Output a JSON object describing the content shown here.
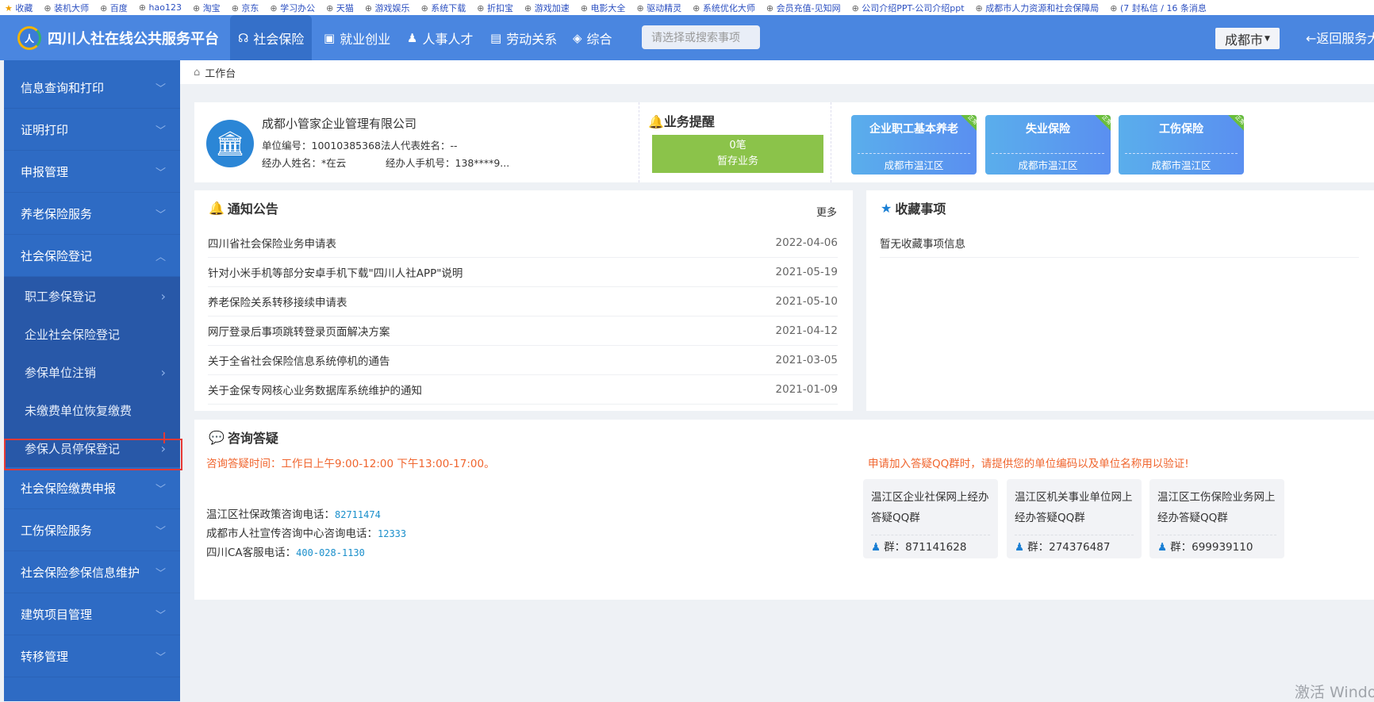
{
  "bookmarks": [
    "收藏",
    "装机大师",
    "百度",
    "hao123",
    "淘宝",
    "京东",
    "学习办公",
    "天猫",
    "游戏娱乐",
    "系统下载",
    "折扣宝",
    "游戏加速",
    "电影大全",
    "驱动精灵",
    "系统优化大师",
    "会员充值-见知网",
    "公司介绍PPT-公司介绍ppt",
    "成都市人力资源和社会保障局",
    "(7 封私信 / 16 条消息"
  ],
  "header": {
    "title": "四川人社在线公共服务平台",
    "nav": [
      {
        "label": "社会保险",
        "icon": "hands-icon"
      },
      {
        "label": "就业创业",
        "icon": "briefcase-icon"
      },
      {
        "label": "人事人才",
        "icon": "person-icon"
      },
      {
        "label": "劳动关系",
        "icon": "document-icon"
      },
      {
        "label": "综合",
        "icon": "layers-icon"
      }
    ],
    "search_placeholder": "请选择或搜索事项",
    "city": "成都市",
    "back": "←返回服务大厅"
  },
  "sidebar": {
    "top": [
      "信息查询和打印",
      "证明打印",
      "申报管理",
      "养老保险服务",
      "社会保险登记"
    ],
    "sub": [
      "职工参保登记",
      "企业社会保险登记",
      "参保单位注销",
      "未缴费单位恢复缴费",
      "参保人员停保登记"
    ],
    "bottom": [
      "社会保险缴费申报",
      "工伤保险服务",
      "社会保险参保信息维护",
      "建筑项目管理",
      "转移管理"
    ]
  },
  "breadcrumb": "工作台",
  "company": {
    "name": "成都小管家企业管理有限公司",
    "unit_no": "单位编号：10010385368",
    "legal": "法人代表姓名：--",
    "agent": "经办人姓名：*在云",
    "agent_phone": "经办人手机号：138****9..."
  },
  "reminder": {
    "title": "业务提醒",
    "count": "0笔",
    "label": "暂存业务"
  },
  "insurance": [
    {
      "name": "企业职工基本养老",
      "area": "成都市温江区",
      "tag": "正常"
    },
    {
      "name": "失业保险",
      "area": "成都市温江区",
      "tag": "正常"
    },
    {
      "name": "工伤保险",
      "area": "成都市温江区",
      "tag": "正常"
    }
  ],
  "notices": {
    "title": "通知公告",
    "more": "更多",
    "items": [
      {
        "t": "四川省社会保险业务申请表",
        "d": "2022-04-06"
      },
      {
        "t": "针对小米手机等部分安卓手机下载\"四川人社APP\"说明",
        "d": "2021-05-19"
      },
      {
        "t": "养老保险关系转移接续申请表",
        "d": "2021-05-10"
      },
      {
        "t": "网厅登录后事项跳转登录页面解决方案",
        "d": "2021-04-12"
      },
      {
        "t": "关于全省社会保险信息系统停机的通告",
        "d": "2021-03-05"
      },
      {
        "t": "关于金保专网核心业务数据库系统维护的通知",
        "d": "2021-01-09"
      }
    ]
  },
  "favorites": {
    "title": "收藏事项",
    "empty": "暂无收藏事项信息"
  },
  "consult": {
    "title": "咨询答疑",
    "hours": "咨询答疑时间：工作日上午9:00-12:00 下午13:00-17:00。",
    "phones": [
      {
        "l": "温江区社保政策咨询电话：",
        "n": "82711474"
      },
      {
        "l": "成都市人社宣传咨询中心咨询电话：",
        "n": "12333"
      },
      {
        "l": "四川CA客服电话：",
        "n": "400-028-1130"
      }
    ],
    "qq_note": "申请加入答疑QQ群时，请提供您的单位编码以及单位名称用以验证!",
    "qq": [
      {
        "name": "温江区企业社保网上经办答疑QQ群",
        "no": "群：871141628"
      },
      {
        "name": "温江区机关事业单位网上经办答疑QQ群",
        "no": "群：274376487"
      },
      {
        "name": "温江区工伤保险业务网上经办答疑QQ群",
        "no": "群：699939110"
      }
    ]
  },
  "watermark": "激活 Windows"
}
